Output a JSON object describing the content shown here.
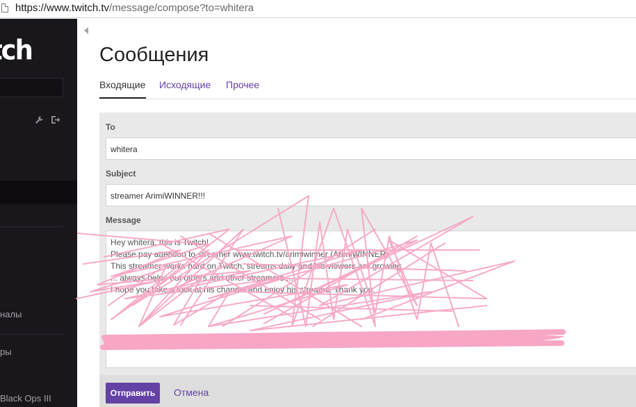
{
  "browser": {
    "url_host": "https://www.twitch.tv",
    "url_rest": "/message/compose?to=whitera",
    "page_icon": "page-icon"
  },
  "sidebar": {
    "logo_text": "tch",
    "icons": [
      "wrench-icon",
      "logout-icon"
    ],
    "items": [
      {
        "label": "налы"
      },
      {
        "label": "ры"
      },
      {
        "label": "Black Ops III"
      }
    ]
  },
  "page": {
    "title": "Сообщения",
    "tabs": [
      {
        "label": "Входящие",
        "active": true
      },
      {
        "label": "Исходящие",
        "active": false
      },
      {
        "label": "Прочее",
        "active": false
      }
    ]
  },
  "form": {
    "to_label": "To",
    "to_value": "whitera",
    "subject_label": "Subject",
    "subject_value": "streamer ArimiWINNER!!!",
    "message_label": "Message",
    "message_lines": [
      "Hey whitera, this is Twitch!",
      "Please pay attention to streamer www.twitch.tv/arimiwinner (ArimiWINNER)",
      "This streamer works hard on Twitch, streams daily and his viewers are growing",
      "... always helps out others and other streamers ...",
      "I hope you take a look at his channel and enjoy his streams. Thank you."
    ],
    "send_label": "Отправить",
    "cancel_label": "Отмена"
  },
  "colors": {
    "accent": "#6441a4",
    "sidebar_bg": "#19171c",
    "scribble": "#f7a6c6"
  }
}
